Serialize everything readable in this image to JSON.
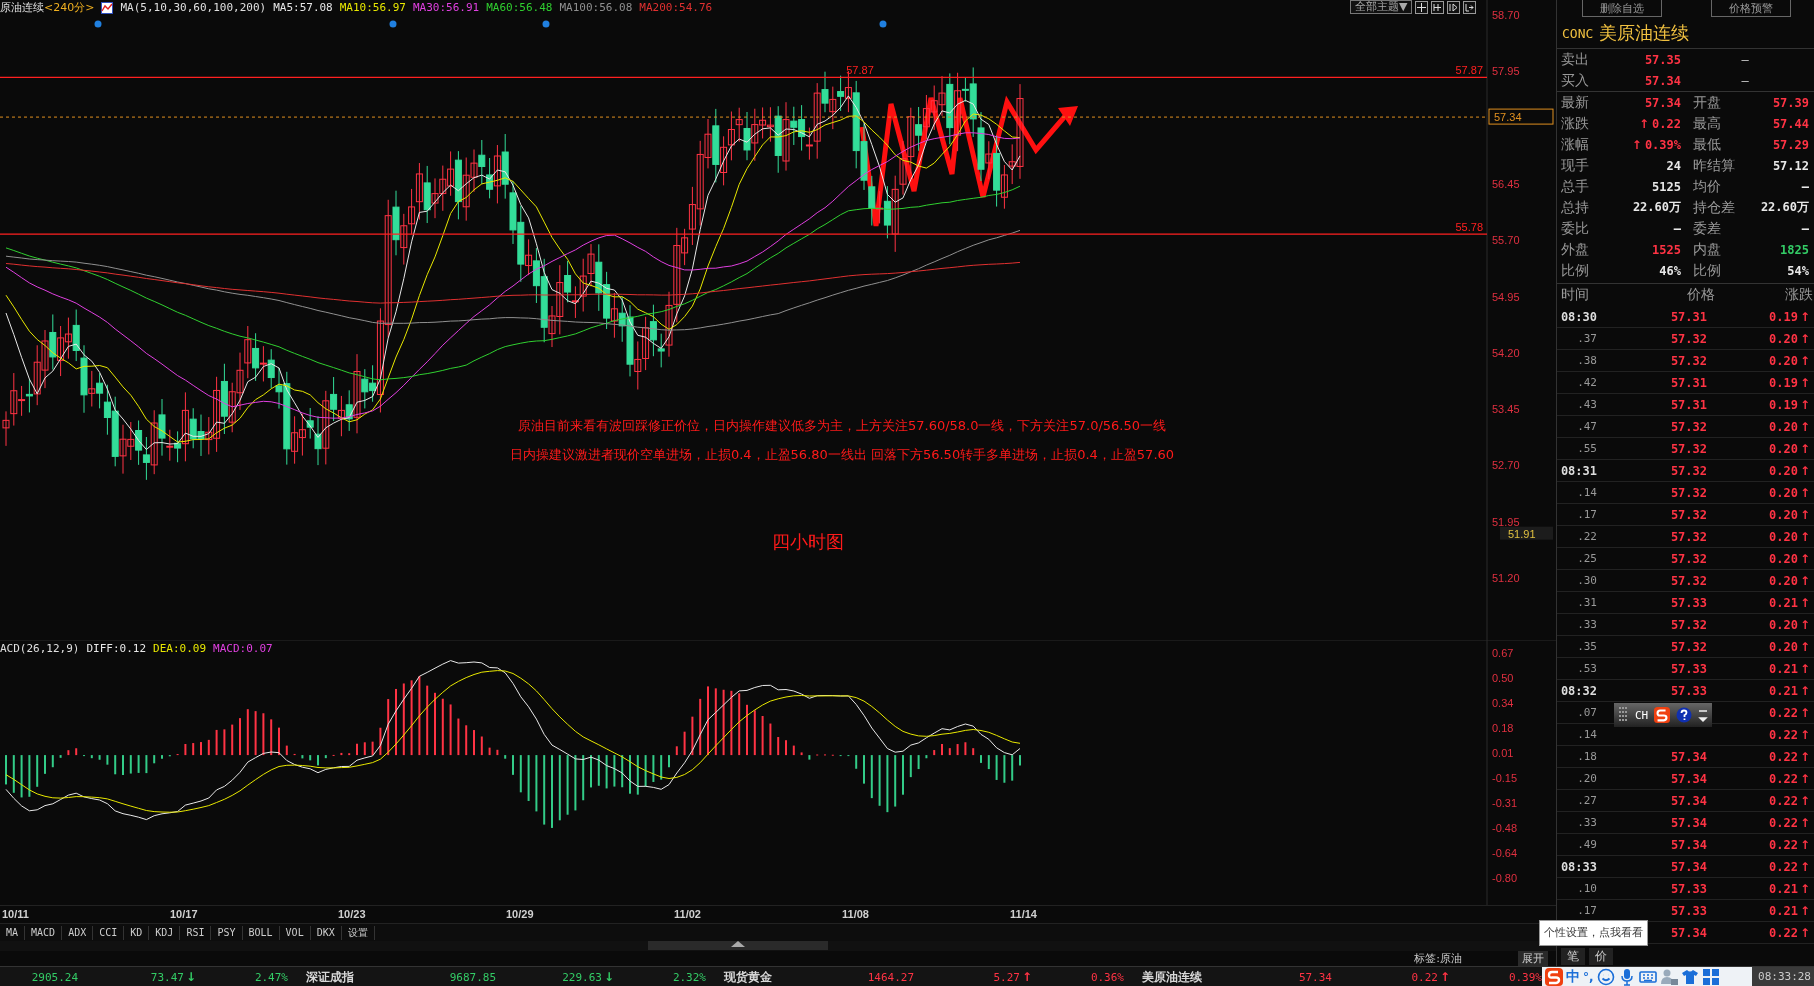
{
  "chart_header": {
    "symbol": "原油连续",
    "period": "<240分>",
    "indicator": "MA(5,10,30,60,100,200)",
    "ma_values": [
      {
        "label": "MA5:57.08",
        "color": "#e8e8e8"
      },
      {
        "label": "MA10:56.97",
        "color": "#e8e800"
      },
      {
        "label": "MA30:56.91",
        "color": "#e040e0"
      },
      {
        "label": "MA60:56.48",
        "color": "#30d030"
      },
      {
        "label": "MA100:56.08",
        "color": "#909090"
      },
      {
        "label": "MA200:54.76",
        "color": "#e03030"
      }
    ]
  },
  "toolbar": {
    "theme_dropdown": "全部主题▼"
  },
  "price_axis": [
    "58.70",
    "57.95",
    "56.45",
    "55.70",
    "54.95",
    "54.20",
    "53.45",
    "52.70",
    "51.95",
    "51.20"
  ],
  "price_lines": [
    {
      "label": "57.87",
      "peak_label": "57.87"
    },
    {
      "label": "55.78"
    }
  ],
  "current_price_tag": "57.34",
  "low_tag": "51.91",
  "annotations": [
    "原油目前来看有波回踩修正价位，日内操作建议低多为主，上方关注57.60/58.0一线，下方关注57.0/56.50一线",
    "日内操建议激进者现价空单进场，止损0.4，止盈56.80一线出 回落下方56.50转手多单进场，止损0.4，止盈57.60"
  ],
  "chart_title": "四小时图",
  "macd_header": {
    "name": "ACD(26,12,9)",
    "values": [
      {
        "label": "DIFF:0.12",
        "color": "#e8e8e8"
      },
      {
        "label": "DEA:0.09",
        "color": "#e8e800"
      },
      {
        "label": "MACD:0.07",
        "color": "#e040e0"
      }
    ]
  },
  "macd_axis": [
    "0.67",
    "0.50",
    "0.34",
    "0.18",
    "0.01",
    "-0.15",
    "-0.31",
    "-0.48",
    "-0.64",
    "-0.80"
  ],
  "dates": [
    "10/11",
    "10/17",
    "10/23",
    "10/29",
    "11/02",
    "11/08",
    "11/14"
  ],
  "indicator_tabs": [
    "MA",
    "MACD",
    "ADX",
    "CCI",
    "KD",
    "KDJ",
    "RSI",
    "PSY",
    "BOLL",
    "VOL",
    "DKX",
    "设置"
  ],
  "tag_label": "标签:原油",
  "expand_button": "展开",
  "quote_panel": {
    "buttons": [
      "删除自选",
      "价格预警"
    ],
    "code": "CONC",
    "name": "美原油连续",
    "bid_ask": [
      {
        "label": "卖出",
        "value": "57.35",
        "extra": "–"
      },
      {
        "label": "买入",
        "value": "57.34",
        "extra": "–"
      }
    ],
    "stats": [
      {
        "label": "最新",
        "value": "57.34",
        "color": "#ff3344"
      },
      {
        "label": "开盘",
        "value": "57.39",
        "color": "#ff3344"
      },
      {
        "label": "涨跌",
        "value": "0.22",
        "color": "#ff3344",
        "arrow": "↑"
      },
      {
        "label": "最高",
        "value": "57.44",
        "color": "#ff3344"
      },
      {
        "label": "涨幅",
        "value": "0.39%",
        "color": "#ff3344",
        "arrow": "↑"
      },
      {
        "label": "最低",
        "value": "57.29",
        "color": "#ff3344"
      },
      {
        "label": "现手",
        "value": "24",
        "color": "#e8e8e8"
      },
      {
        "label": "昨结算",
        "value": "57.12",
        "color": "#e8e8e8"
      },
      {
        "label": "总手",
        "value": "5125",
        "color": "#e8e8e8"
      },
      {
        "label": "均价",
        "value": "–",
        "color": "#e8e8e8"
      },
      {
        "label": "总持",
        "value": "22.60万",
        "color": "#e8e8e8"
      },
      {
        "label": "持仓差",
        "value": "22.60万",
        "color": "#e8e8e8"
      },
      {
        "label": "委比",
        "value": "–",
        "color": "#e8e8e8"
      },
      {
        "label": "委差",
        "value": "–",
        "color": "#e8e8e8"
      },
      {
        "label": "外盘",
        "value": "1525",
        "color": "#ff3344"
      },
      {
        "label": "内盘",
        "value": "1825",
        "color": "#33cc66"
      },
      {
        "label": "比例",
        "value": "46%",
        "color": "#e8e8e8"
      },
      {
        "label": "比例",
        "value": "54%",
        "color": "#e8e8e8"
      }
    ],
    "tick_columns": [
      "时间",
      "价格",
      "涨跌"
    ],
    "ticks": [
      {
        "time": "08:30",
        "kind": "minute",
        "price": "57.31",
        "change": "0.19",
        "arrow": "↑"
      },
      {
        "time": ".37",
        "kind": "second",
        "price": "57.32",
        "change": "0.20",
        "arrow": "↑"
      },
      {
        "time": ".38",
        "kind": "second",
        "price": "57.32",
        "change": "0.20",
        "arrow": "↑"
      },
      {
        "time": ".42",
        "kind": "second",
        "price": "57.31",
        "change": "0.19",
        "arrow": "↑"
      },
      {
        "time": ".43",
        "kind": "second",
        "price": "57.31",
        "change": "0.19",
        "arrow": "↑"
      },
      {
        "time": ".47",
        "kind": "second",
        "price": "57.32",
        "change": "0.20",
        "arrow": "↑"
      },
      {
        "time": ".55",
        "kind": "second",
        "price": "57.32",
        "change": "0.20",
        "arrow": "↑"
      },
      {
        "time": "08:31",
        "kind": "minute",
        "price": "57.32",
        "change": "0.20",
        "arrow": "↑"
      },
      {
        "time": ".14",
        "kind": "second",
        "price": "57.32",
        "change": "0.20",
        "arrow": "↑"
      },
      {
        "time": ".17",
        "kind": "second",
        "price": "57.32",
        "change": "0.20",
        "arrow": "↑"
      },
      {
        "time": ".22",
        "kind": "second",
        "price": "57.32",
        "change": "0.20",
        "arrow": "↑"
      },
      {
        "time": ".25",
        "kind": "second",
        "price": "57.32",
        "change": "0.20",
        "arrow": "↑"
      },
      {
        "time": ".30",
        "kind": "second",
        "price": "57.32",
        "change": "0.20",
        "arrow": "↑"
      },
      {
        "time": ".31",
        "kind": "second",
        "price": "57.33",
        "change": "0.21",
        "arrow": "↑"
      },
      {
        "time": ".33",
        "kind": "second",
        "price": "57.32",
        "change": "0.20",
        "arrow": "↑"
      },
      {
        "time": ".35",
        "kind": "second",
        "price": "57.32",
        "change": "0.20",
        "arrow": "↑"
      },
      {
        "time": ".53",
        "kind": "second",
        "price": "57.33",
        "change": "0.21",
        "arrow": "↑"
      },
      {
        "time": "08:32",
        "kind": "minute",
        "price": "57.33",
        "change": "0.21",
        "arrow": "↑"
      },
      {
        "time": ".07",
        "kind": "second",
        "change": "0.22",
        "arrow": "↑"
      },
      {
        "time": ".14",
        "kind": "second",
        "change": "0.22",
        "arrow": "↑"
      },
      {
        "time": ".18",
        "kind": "second",
        "price": "57.34",
        "change": "0.22",
        "arrow": "↑"
      },
      {
        "time": ".20",
        "kind": "second",
        "price": "57.34",
        "change": "0.22",
        "arrow": "↑"
      },
      {
        "time": ".27",
        "kind": "second",
        "price": "57.34",
        "change": "0.22",
        "arrow": "↑"
      },
      {
        "time": ".33",
        "kind": "second",
        "price": "57.34",
        "change": "0.22",
        "arrow": "↑"
      },
      {
        "time": ".49",
        "kind": "second",
        "price": "57.34",
        "change": "0.22",
        "arrow": "↑"
      },
      {
        "time": "08:33",
        "kind": "minute",
        "price": "57.34",
        "change": "0.22",
        "arrow": "↑"
      },
      {
        "time": ".10",
        "kind": "second",
        "price": "57.33",
        "change": "0.21",
        "arrow": "↑"
      },
      {
        "time": ".17",
        "kind": "second",
        "price": "57.33",
        "change": "0.21",
        "arrow": "↑"
      },
      {
        "price": "57.34",
        "change": "0.22",
        "arrow": "↑"
      }
    ],
    "panel_tabs": [
      "笔",
      "价"
    ]
  },
  "ticker": [
    {
      "text": "2905.24",
      "kind": "price",
      "color": "#33cc66"
    },
    {
      "text": "73.47",
      "kind": "change",
      "color": "#33cc66",
      "arrow": "↓"
    },
    {
      "text": "2.47%",
      "kind": "pct",
      "color": "#33cc66"
    },
    {
      "text": "深证成指",
      "kind": "name",
      "color": "#d8d8d8"
    },
    {
      "text": "9687.85",
      "kind": "price",
      "color": "#33cc66"
    },
    {
      "text": "229.63",
      "kind": "change",
      "color": "#33cc66",
      "arrow": "↓"
    },
    {
      "text": "2.32%",
      "kind": "pct",
      "color": "#33cc66"
    },
    {
      "text": "现货黄金",
      "kind": "name",
      "color": "#d8d8d8"
    },
    {
      "text": "1464.27",
      "kind": "price",
      "color": "#ff3344"
    },
    {
      "text": "5.27",
      "kind": "change",
      "color": "#ff3344",
      "arrow": "↑"
    },
    {
      "text": "0.36%",
      "kind": "pct",
      "color": "#ff3344"
    },
    {
      "text": "美原油连续",
      "kind": "name",
      "color": "#d8d8d8"
    },
    {
      "text": "57.34",
      "kind": "price",
      "color": "#ff3344"
    },
    {
      "text": "0.22",
      "kind": "change",
      "color": "#ff3344",
      "arrow": "↑"
    },
    {
      "text": "0.39%",
      "kind": "pct",
      "color": "#ff3344"
    }
  ],
  "ime_toolbar": {
    "mode": "CH"
  },
  "tooltip": "个性设置，点我看看",
  "taskbar": {
    "ime_mode": "中",
    "punctuation": "°,",
    "clock": "08:33:28"
  }
}
